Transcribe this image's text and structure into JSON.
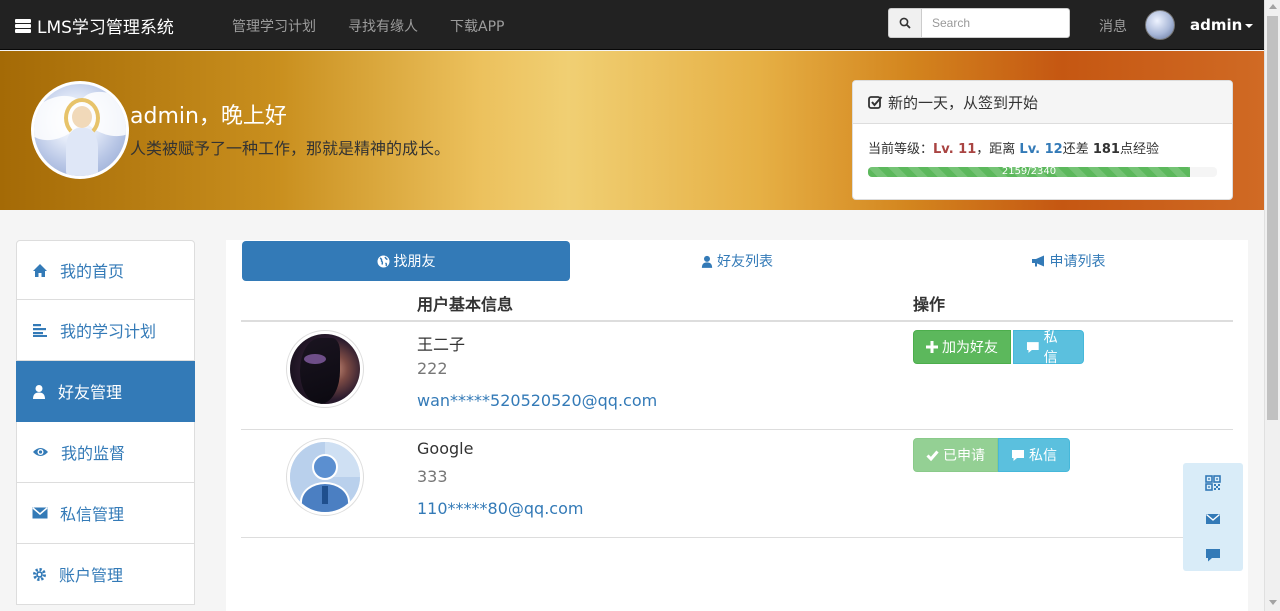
{
  "navbar": {
    "brand": "LMS学习管理系统",
    "links": [
      "管理学习计划",
      "寻找有缘人",
      "下载APP"
    ],
    "search_placeholder": "Search",
    "messages": "消息",
    "user": "admin"
  },
  "hero": {
    "greeting": "admin，晚上好",
    "quote": "人类被赋予了一种工作，那就是精神的成长。"
  },
  "sign": {
    "title": "新的一天，从签到开始",
    "prefix": "当前等级：",
    "current_level": "Lv. 11",
    "mid": "，距离 ",
    "next_level": "Lv. 12",
    "diff_label": "还差 ",
    "diff": "181",
    "suffix": "点经验",
    "progress_text": "2159/2340",
    "progress_fraction": 0.9226
  },
  "sidebar": {
    "items": [
      {
        "label": "我的首页",
        "icon": "home-icon"
      },
      {
        "label": "我的学习计划",
        "icon": "align-left-icon"
      },
      {
        "label": "好友管理",
        "icon": "user-icon",
        "active": true
      },
      {
        "label": "我的监督",
        "icon": "eye-icon"
      },
      {
        "label": "私信管理",
        "icon": "envelope-icon"
      },
      {
        "label": "账户管理",
        "icon": "gear-icon"
      }
    ]
  },
  "tabs": [
    {
      "label": "找朋友",
      "icon": "globe-icon",
      "active": true
    },
    {
      "label": "好友列表",
      "icon": "user-icon"
    },
    {
      "label": "申请列表",
      "icon": "bullhorn-icon"
    }
  ],
  "table": {
    "col_info": "用户基本信息",
    "col_action": "操作",
    "rows": [
      {
        "name": "王二子",
        "id": "222",
        "email": "wan*****520520520@qq.com",
        "primary_action": "加为好友",
        "primary_icon": "plus-icon",
        "primary_disabled": false,
        "secondary_action": "私信"
      },
      {
        "name": "Google",
        "id": "333",
        "email": "110*****80@qq.com",
        "primary_action": "已申请",
        "primary_icon": "check-icon",
        "primary_disabled": true,
        "secondary_action": "私信"
      }
    ]
  },
  "colors": {
    "primary": "#337ab7",
    "success": "#5cb85c",
    "info": "#5bc0de",
    "navbar": "#222222"
  }
}
